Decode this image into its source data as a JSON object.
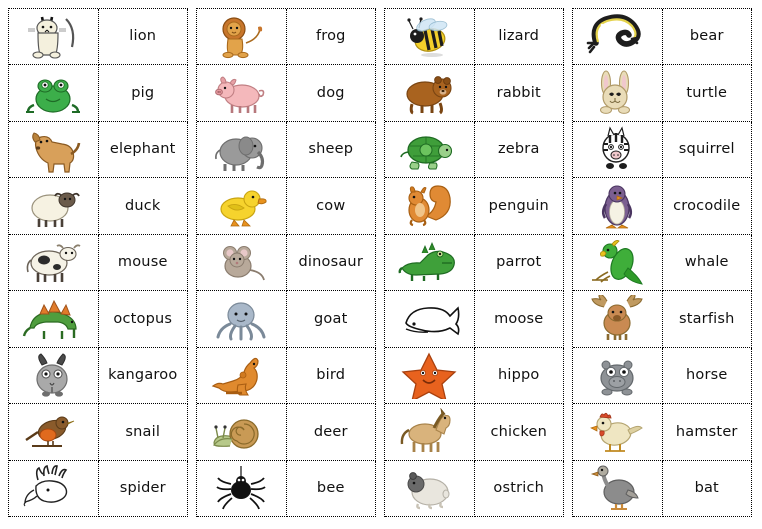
{
  "worksheet": {
    "title": "Animal picture-word matching worksheet",
    "layout": {
      "column_groups": 4,
      "rows_per_group": 9,
      "cells_per_row": 2,
      "border_style": "dotted",
      "border_color": "#000000",
      "background": "#ffffff"
    }
  },
  "columns": [
    {
      "index": 1,
      "name": "column-1",
      "rows": [
        {
          "picture": "cat",
          "word": "lion"
        },
        {
          "picture": "frog",
          "word": "pig"
        },
        {
          "picture": "dog",
          "word": "elephant"
        },
        {
          "picture": "sheep",
          "word": "duck"
        },
        {
          "picture": "cow",
          "word": "mouse"
        },
        {
          "picture": "dinosaur",
          "word": "octopus"
        },
        {
          "picture": "goat",
          "word": "kangaroo"
        },
        {
          "picture": "bird",
          "word": "snail"
        },
        {
          "picture": "deer",
          "word": "spider"
        }
      ]
    },
    {
      "index": 2,
      "name": "column-2",
      "rows": [
        {
          "picture": "lion",
          "word": "frog"
        },
        {
          "picture": "pig",
          "word": "dog"
        },
        {
          "picture": "elephant",
          "word": "sheep"
        },
        {
          "picture": "duck",
          "word": "cow"
        },
        {
          "picture": "mouse",
          "word": "dinosaur"
        },
        {
          "picture": "octopus",
          "word": "goat"
        },
        {
          "picture": "kangaroo",
          "word": "bird"
        },
        {
          "picture": "snail",
          "word": "deer"
        },
        {
          "picture": "spider",
          "word": "bee"
        }
      ]
    },
    {
      "index": 3,
      "name": "column-3",
      "rows": [
        {
          "picture": "bee",
          "word": "lizard"
        },
        {
          "picture": "bear",
          "word": "rabbit"
        },
        {
          "picture": "turtle",
          "word": "zebra"
        },
        {
          "picture": "squirrel",
          "word": "penguin"
        },
        {
          "picture": "crocodile",
          "word": "parrot"
        },
        {
          "picture": "whale",
          "word": "moose"
        },
        {
          "picture": "starfish",
          "word": "hippo"
        },
        {
          "picture": "horse",
          "word": "chicken"
        },
        {
          "picture": "hamster",
          "word": "ostrich"
        }
      ]
    },
    {
      "index": 4,
      "name": "column-4",
      "rows": [
        {
          "picture": "lizard",
          "word": "bear"
        },
        {
          "picture": "rabbit",
          "word": "turtle"
        },
        {
          "picture": "zebra",
          "word": "squirrel"
        },
        {
          "picture": "penguin",
          "word": "crocodile"
        },
        {
          "picture": "parrot",
          "word": "whale"
        },
        {
          "picture": "moose",
          "word": "starfish"
        },
        {
          "picture": "hippo",
          "word": "horse"
        },
        {
          "picture": "chicken",
          "word": "hamster"
        },
        {
          "picture": "ostrich",
          "word": "bat"
        }
      ]
    }
  ],
  "palette": {
    "cat_body": "#f4f0dd",
    "frog_green": "#3cae4a",
    "dog_tan": "#d8a05a",
    "sheep_wool": "#f6f2e2",
    "cow_white": "#f5f2e6",
    "dino_green": "#4f9e3e",
    "dino_plate": "#e07b2a",
    "goat_grey": "#a9a9a9",
    "bird_brown": "#8a5b2b",
    "bird_breast": "#e06a1e",
    "deer_white": "#ffffff",
    "lion_gold": "#e2a34a",
    "lion_mane": "#c8762c",
    "pig_pink": "#f4b8bb",
    "elephant_grey": "#9a9a9a",
    "duck_yellow": "#f6d32d",
    "mouse_grey": "#b8a99a",
    "octopus_blue": "#a9b8c9",
    "kangaroo_orange": "#e08a2e",
    "snail_shell": "#c99a55",
    "snail_body": "#b7c98a",
    "spider_black": "#111111",
    "bee_yellow": "#f3d02a",
    "bear_brown": "#a9631f",
    "turtle_green": "#3f9e3a",
    "squirrel_orange": "#e08a34",
    "croc_green": "#3fa03a",
    "whale_white": "#ffffff",
    "starfish_orange": "#e8621e",
    "horse_tan": "#d9b37c",
    "hamster_white": "#e9e6de",
    "lizard_yellow": "#e4d24a",
    "rabbit_cream": "#e9dcb8",
    "zebra_white": "#ffffff",
    "penguin_purple": "#7b5f90",
    "parrot_green": "#3fae3a",
    "moose_brown": "#c98a52",
    "hippo_grey": "#8e9296",
    "chicken_cream": "#efe6c2",
    "ostrich_grey": "#8c8c8c"
  }
}
